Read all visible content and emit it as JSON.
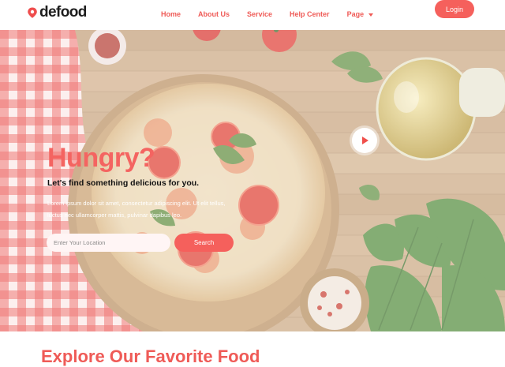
{
  "brand": {
    "name": "defood",
    "icon": "location-pin-icon",
    "color": "#ef4d4d"
  },
  "nav": {
    "items": [
      {
        "label": "Home"
      },
      {
        "label": "About Us"
      },
      {
        "label": "Service"
      },
      {
        "label": "Help Center"
      },
      {
        "label": "Page",
        "has_dropdown": true
      }
    ],
    "login_label": "Login"
  },
  "hero": {
    "title": "Hungry?",
    "subtitle": "Let's find something delicious for you.",
    "body": "Lorem ipsum dolor sit amet, consectetur adipiscing elit. Ut elit tellus, luctus nec ullamcorper mattis, pulvinar dapibus leo.",
    "search_placeholder": "Enter Your Location",
    "search_label": "Search",
    "video_icon": "play-icon"
  },
  "next_section": {
    "heading_peek": "Explore Our Favorite Food"
  },
  "colors": {
    "accent": "#f5605c",
    "nav_text": "#ef5b57",
    "headline": "#f46461"
  }
}
